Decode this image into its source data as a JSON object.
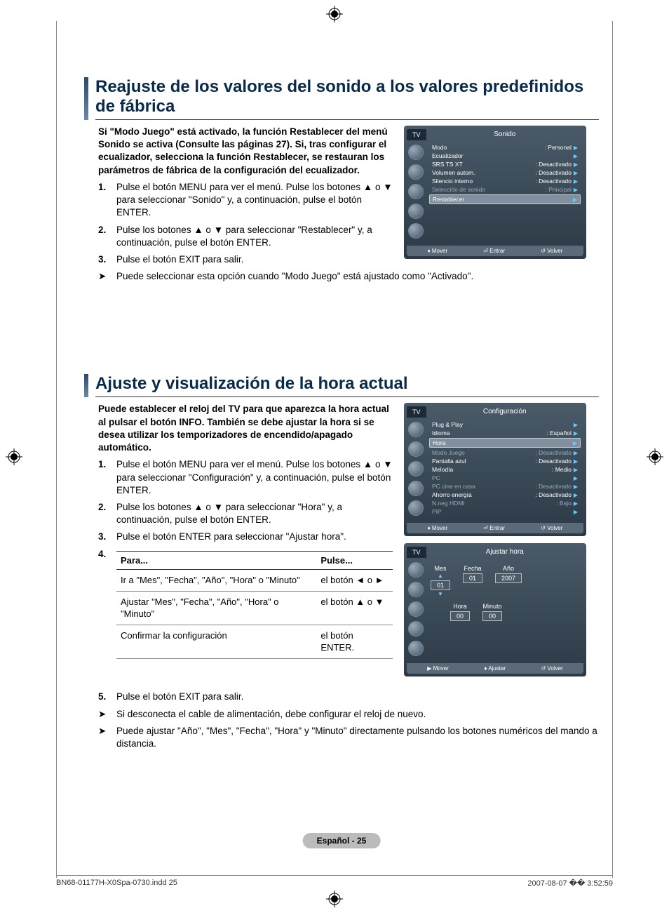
{
  "section1": {
    "title": "Reajuste de los valores del sonido a los valores predefinidos de fábrica",
    "intro": "Si \"Modo Juego\" está activado, la función Restablecer del menú Sonido se activa (Consulte las páginas 27). Si, tras configurar el ecualizador, selecciona la función Restablecer, se restauran los parámetros de fábrica de la configuración del ecualizador.",
    "steps": {
      "s1": "Pulse el botón MENU para ver el menú. Pulse los botones ▲ o ▼ para seleccionar \"Sonido\" y, a continuación, pulse el botón ENTER.",
      "s2": "Pulse los botones ▲ o ▼ para seleccionar \"Restablecer\" y, a continuación, pulse el botón ENTER.",
      "s3": "Pulse el botón EXIT para salir."
    },
    "note": "Puede seleccionar esta opción cuando \"Modo Juego\" está ajustado como \"Activado\"."
  },
  "section2": {
    "title": "Ajuste y visualización de la hora actual",
    "intro": "Puede establecer el reloj del TV para que aparezca la hora actual al pulsar el botón INFO. También se debe ajustar la hora si se desea utilizar los temporizadores de encendido/apagado automático.",
    "steps": {
      "s1": "Pulse el botón MENU para ver el menú. Pulse los botones ▲ o ▼ para seleccionar \"Configuración\" y, a continuación, pulse el botón ENTER.",
      "s2": "Pulse los botones ▲ o ▼ para seleccionar \"Hora\" y, a continuación, pulse el botón ENTER.",
      "s3": "Pulse el botón ENTER para seleccionar \"Ajustar hora\".",
      "s5": "Pulse el botón EXIT para salir."
    },
    "table": {
      "head_para": "Para...",
      "head_pulse": "Pulse...",
      "r1_para": "Ir a \"Mes\", \"Fecha\", \"Año\", \"Hora\" o \"Minuto\"",
      "r1_pulse": "el botón ◄ o ►",
      "r2_para": "Ajustar \"Mes\", \"Fecha\", \"Año\", \"Hora\" o \"Minuto\"",
      "r2_pulse": "el botón ▲ o ▼",
      "r3_para": "Confirmar la configuración",
      "r3_pulse": "el botón ENTER."
    },
    "note1": "Si desconecta el cable de alimentación, debe configurar el reloj de nuevo.",
    "note2": "Puede ajustar \"Año\", \"Mes\", \"Fecha\", \"Hora\" y \"Minuto\" directamente pulsando los botones numéricos del mando a distancia."
  },
  "osd_sound": {
    "tv": "TV",
    "title": "Sonido",
    "rows": [
      {
        "k": "Modo",
        "v": ": Personal"
      },
      {
        "k": "Ecualizador",
        "v": ""
      },
      {
        "k": "SRS TS XT",
        "v": ": Desactivado"
      },
      {
        "k": "Volumen autom.",
        "v": ": Desactivado"
      },
      {
        "k": "Silencio interno",
        "v": ": Desactivado"
      },
      {
        "k": "Selección de sonido",
        "v": ": Principal",
        "dim": true
      },
      {
        "k": "Restablecer",
        "v": "",
        "hl": true
      }
    ],
    "foot": {
      "mover": "Mover",
      "entrar": "Entrar",
      "volver": "Volver"
    }
  },
  "osd_config": {
    "tv": "TV",
    "title": "Configuración",
    "rows": [
      {
        "k": "Plug & Play",
        "v": ""
      },
      {
        "k": "Idioma",
        "v": ": Español"
      },
      {
        "k": "Hora",
        "v": "",
        "hl": true
      },
      {
        "k": "Modo Juego",
        "v": ": Desactivado",
        "dim": true
      },
      {
        "k": "Pantalla azul",
        "v": ": Desactivado"
      },
      {
        "k": "Melodía",
        "v": ": Medio"
      },
      {
        "k": "PC",
        "v": "",
        "dim": true
      },
      {
        "k": "PC cine en casa",
        "v": ": Desactivado",
        "dim": true
      },
      {
        "k": "Ahorro energía",
        "v": ": Desactivado"
      },
      {
        "k": "N.neg HDMI",
        "v": ": Bajo",
        "dim": true
      },
      {
        "k": "PIP",
        "v": "",
        "dim": true
      }
    ],
    "foot": {
      "mover": "Mover",
      "entrar": "Entrar",
      "volver": "Volver"
    }
  },
  "osd_clock": {
    "tv": "TV",
    "title": "Ajustar hora",
    "labels": {
      "mes": "Mes",
      "fecha": "Fecha",
      "ano": "Año",
      "hora": "Hora",
      "minuto": "Minuto"
    },
    "vals": {
      "mes": "01",
      "fecha": "01",
      "ano": "2007",
      "hora": "00",
      "minuto": "00"
    },
    "foot": {
      "mover": "Mover",
      "ajustar": "Ajustar",
      "volver": "Volver"
    }
  },
  "nums": {
    "n1": "1.",
    "n2": "2.",
    "n3": "3.",
    "n4": "4.",
    "n5": "5."
  },
  "footer": {
    "page": "Español - 25",
    "file": "BN68-01177H-X0Spa-0730.indd   25",
    "date": "2007-08-07   �� 3:52:59"
  }
}
